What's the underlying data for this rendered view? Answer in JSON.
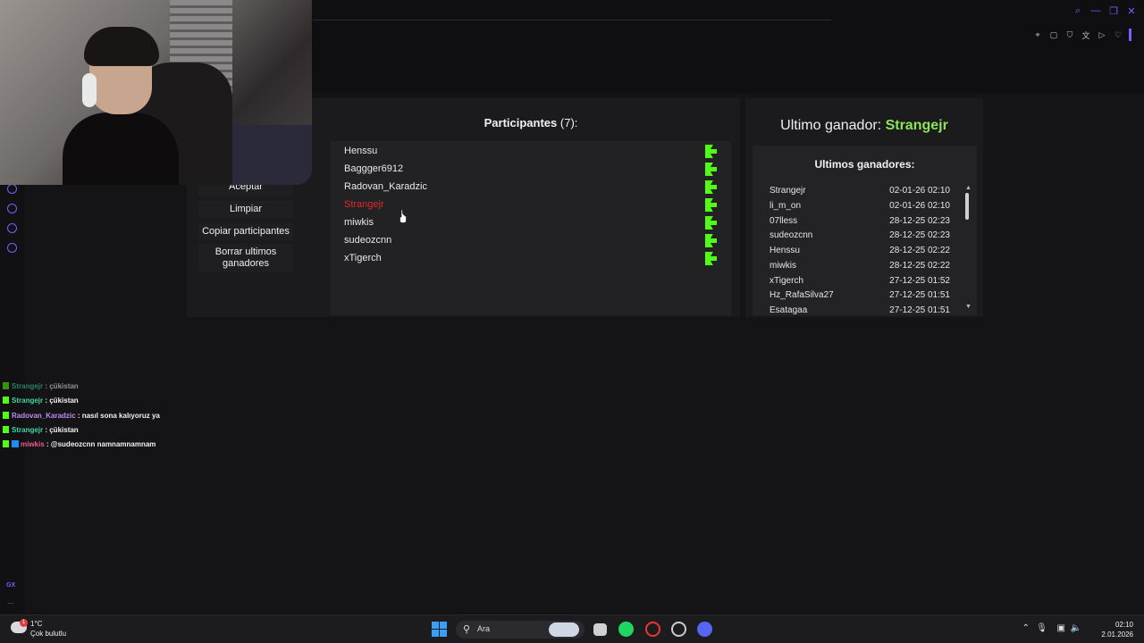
{
  "left_panel": {
    "buttons": [
      "Aceptar",
      "Limpiar",
      "Copiar participantes",
      "Borrar ultimos ganadores"
    ]
  },
  "participants": {
    "title": "Participantes",
    "count": "(7):",
    "list": [
      {
        "name": "Henssu",
        "selected": false
      },
      {
        "name": "Baggger6912",
        "selected": false
      },
      {
        "name": "Radovan_Karadzic",
        "selected": false
      },
      {
        "name": "Strangejr",
        "selected": true
      },
      {
        "name": "miwkis",
        "selected": false
      },
      {
        "name": "sudeozcnn",
        "selected": false
      },
      {
        "name": "xTigerch",
        "selected": false
      }
    ]
  },
  "winner": {
    "label": "Ultimo ganador:",
    "name": "Strangejr",
    "list_title": "Ultimos ganadores:",
    "list": [
      {
        "name": "Strangejr",
        "date": "02-01-26 02:10"
      },
      {
        "name": "li_m_on",
        "date": "02-01-26 02:10"
      },
      {
        "name": "07lless",
        "date": "28-12-25 02:23"
      },
      {
        "name": "sudeozcnn",
        "date": "28-12-25 02:23"
      },
      {
        "name": "Henssu",
        "date": "28-12-25 02:22"
      },
      {
        "name": "miwkis",
        "date": "28-12-25 02:22"
      },
      {
        "name": "xTigerch",
        "date": "27-12-25 01:52"
      },
      {
        "name": "Hz_RafaSilva27",
        "date": "27-12-25 01:51"
      },
      {
        "name": "Esatagaa",
        "date": "27-12-25 01:51"
      }
    ]
  },
  "chat": [
    {
      "user": "Strangejr",
      "msg": " : çükistan",
      "color": "#3fd6a0",
      "badge": false,
      "faded": true
    },
    {
      "user": "Strangejr",
      "msg": " : çükistan",
      "color": "#3fd6a0",
      "badge": false,
      "faded": false
    },
    {
      "user": "Radovan_Karadzic",
      "msg": " : nasıl sona kalıyoruz ya",
      "color": "#c08cf0",
      "badge": false,
      "faded": false
    },
    {
      "user": "Strangejr",
      "msg": " : çükistan",
      "color": "#3fd6a0",
      "badge": false,
      "faded": false
    },
    {
      "user": "miwkis",
      "msg": " : @sudeozcnn namnamnamnam",
      "color": "#f05a8c",
      "badge": true,
      "faded": false
    }
  ],
  "taskbar": {
    "weather_temp": "1°C",
    "weather_desc": "Çok bulutlu",
    "weather_badge": "1",
    "search_label": "Ara",
    "time": "02:10",
    "date": "2.01.2026"
  },
  "sidebar_gx_label": "GX",
  "sidebar_more": "...",
  "colors": {
    "accent": "#7b5cff",
    "kick_green": "#53fc18",
    "winner_green": "#8fe35a",
    "selected_red": "#e02a2a"
  },
  "icons": [
    "search-icon",
    "minimize-icon",
    "restore-icon",
    "close-icon",
    "pin-icon",
    "snapshot-icon",
    "shield-icon",
    "translate-icon",
    "send-icon",
    "heart-icon",
    "kick-icon",
    "windows-icon",
    "spotify-icon",
    "opera-icon",
    "discord-icon"
  ]
}
